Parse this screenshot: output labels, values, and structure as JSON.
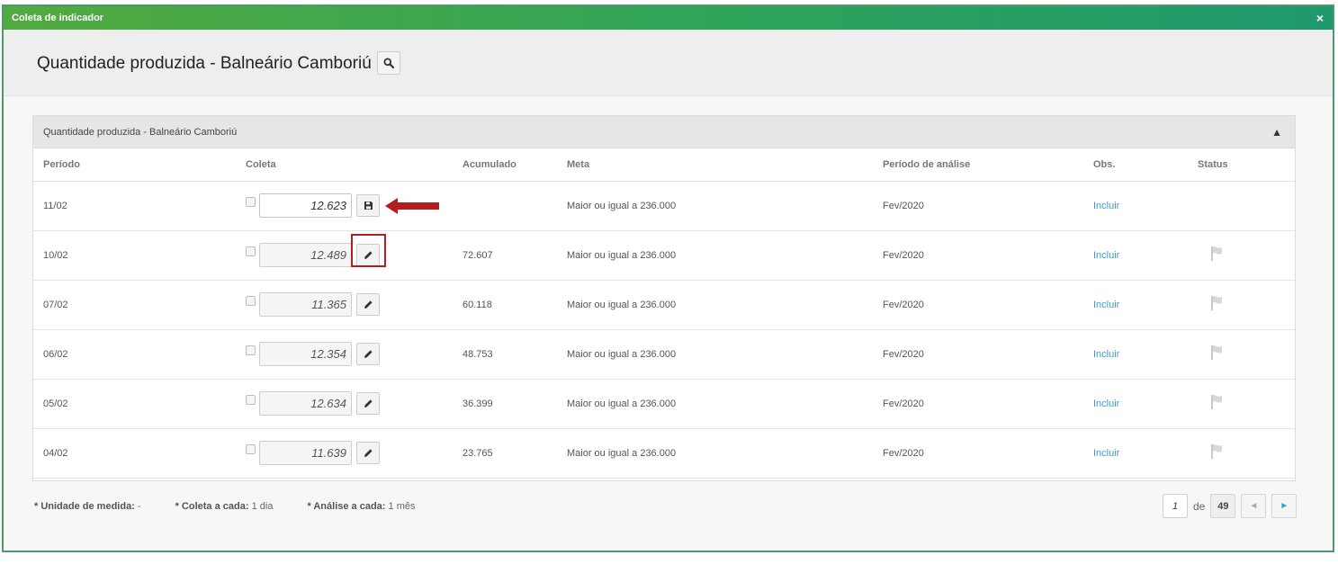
{
  "window": {
    "title": "Coleta de indicador",
    "close_label": "×"
  },
  "header": {
    "title": "Quantidade produzida - Balneário Camboriú"
  },
  "panel": {
    "title": "Quantidade produzida - Balneário Camboriú",
    "collapse_label": "▲",
    "columns": [
      "Período",
      "Coleta",
      "Acumulado",
      "Meta",
      "Período de análise",
      "Obs.",
      "Status"
    ],
    "rows": [
      {
        "periodo": "11/02",
        "coleta": "12.623",
        "acumulado": "",
        "meta": "Maior ou igual a 236.000",
        "analise": "Fev/2020",
        "obs": "Incluir"
      },
      {
        "periodo": "10/02",
        "coleta": "12.489",
        "acumulado": "72.607",
        "meta": "Maior ou igual a 236.000",
        "analise": "Fev/2020",
        "obs": "Incluir"
      },
      {
        "periodo": "07/02",
        "coleta": "11.365",
        "acumulado": "60.118",
        "meta": "Maior ou igual a 236.000",
        "analise": "Fev/2020",
        "obs": "Incluir"
      },
      {
        "periodo": "06/02",
        "coleta": "12.354",
        "acumulado": "48.753",
        "meta": "Maior ou igual a 236.000",
        "analise": "Fev/2020",
        "obs": "Incluir"
      },
      {
        "periodo": "05/02",
        "coleta": "12.634",
        "acumulado": "36.399",
        "meta": "Maior ou igual a 236.000",
        "analise": "Fev/2020",
        "obs": "Incluir"
      },
      {
        "periodo": "04/02",
        "coleta": "11.639",
        "acumulado": "23.765",
        "meta": "Maior ou igual a 236.000",
        "analise": "Fev/2020",
        "obs": "Incluir"
      }
    ]
  },
  "footer": {
    "unidade_label": "* Unidade de medida:",
    "unidade_value": "-",
    "coleta_label": "* Coleta a cada:",
    "coleta_value": "1 dia",
    "analise_label": "* Análise a cada:",
    "analise_value": "1 mês"
  },
  "pagination": {
    "current_page": "1",
    "of_label": "de",
    "total_pages": "49",
    "prev_label": "◄",
    "next_label": "►"
  },
  "colors": {
    "titlebar_start": "#52ab3f",
    "titlebar_end": "#1f9a6e",
    "link": "#3d9bd6",
    "highlight": "#b51e1e"
  }
}
